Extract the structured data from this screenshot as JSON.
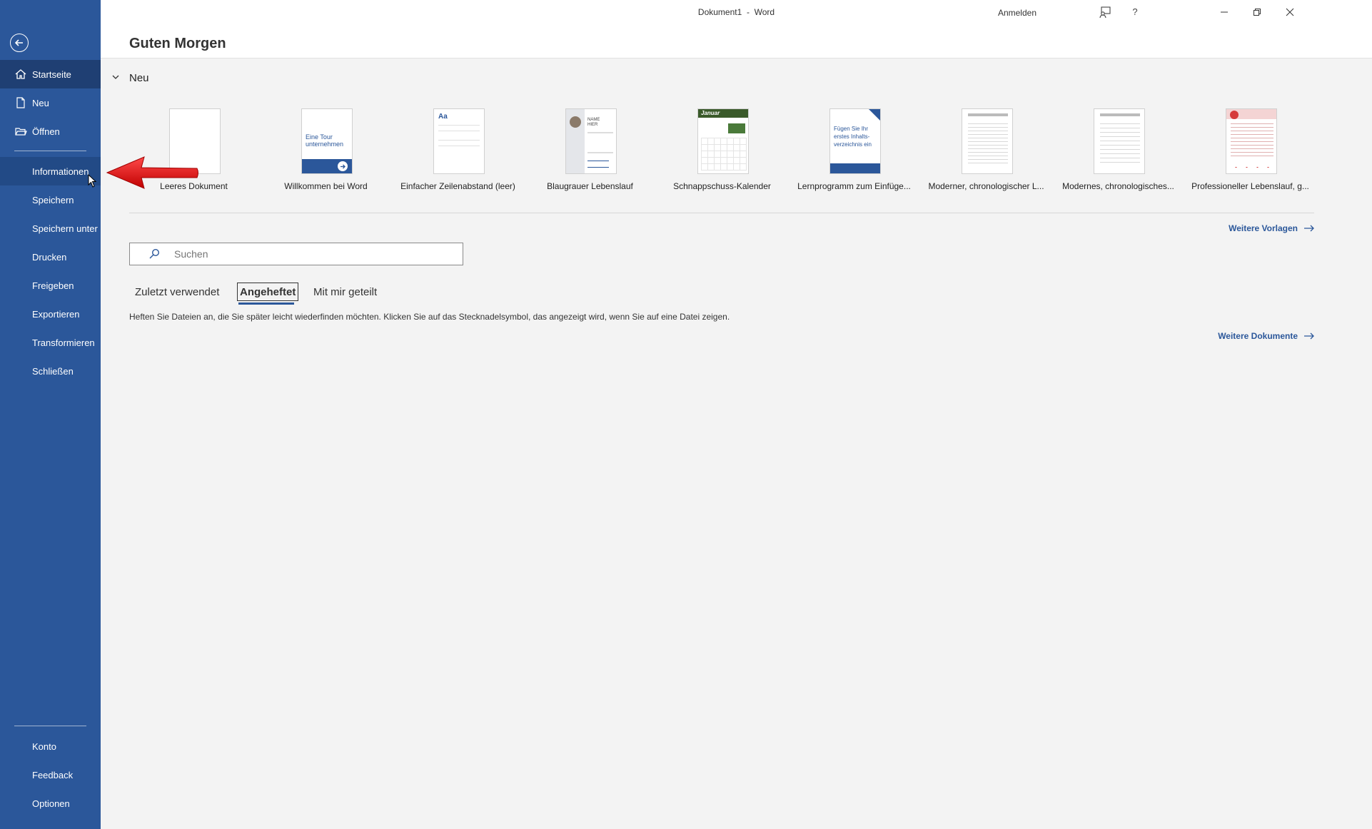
{
  "window": {
    "title": "Dokument1  -  Word",
    "signin_label": "Anmelden"
  },
  "sidebar": {
    "top_items": [
      {
        "label": "Startseite",
        "icon": "home-icon"
      },
      {
        "label": "Neu",
        "icon": "new-document-icon"
      },
      {
        "label": "Öffnen",
        "icon": "folder-open-icon"
      }
    ],
    "middle_items": [
      {
        "label": "Informationen"
      },
      {
        "label": "Speichern"
      },
      {
        "label": "Speichern unter"
      },
      {
        "label": "Drucken"
      },
      {
        "label": "Freigeben"
      },
      {
        "label": "Exportieren"
      },
      {
        "label": "Transformieren"
      },
      {
        "label": "Schließen"
      }
    ],
    "bottom_items": [
      {
        "label": "Konto"
      },
      {
        "label": "Feedback"
      },
      {
        "label": "Optionen"
      }
    ],
    "active_item": "Startseite",
    "hovered_item": "Informationen"
  },
  "main": {
    "greeting": "Guten Morgen",
    "new_section_title": "Neu",
    "templates": [
      {
        "name": "Leeres Dokument"
      },
      {
        "name": "Willkommen bei Word",
        "thumb_text": "Eine Tour unternehmen"
      },
      {
        "name": "Einfacher Zeilenabstand (leer)",
        "thumb_text": "Aa"
      },
      {
        "name": "Blaugrauer Lebenslauf",
        "thumb_text": "NAME HIER"
      },
      {
        "name": "Schnappschuss-Kalender",
        "thumb_text": "Januar"
      },
      {
        "name": "Lernprogramm zum Einfüge...",
        "thumb_text": "Fügen Sie Ihr erstes Inhalts-verzeichnis ein"
      },
      {
        "name": "Moderner, chronologischer L..."
      },
      {
        "name": "Modernes, chronologisches..."
      },
      {
        "name": "Professioneller Lebenslauf, g..."
      }
    ],
    "more_templates_label": "Weitere Vorlagen",
    "search": {
      "placeholder": "Suchen"
    },
    "tabs": [
      {
        "label": "Zuletzt verwendet"
      },
      {
        "label": "Angeheftet"
      },
      {
        "label": "Mit mir geteilt"
      }
    ],
    "selected_tab": "Angeheftet",
    "pinned_info": "Heften Sie Dateien an, die Sie später leicht wiederfinden möchten. Klicken Sie auf das Stecknadelsymbol, das angezeigt wird, wenn Sie auf eine Datei zeigen.",
    "more_documents_label": "Weitere Dokumente"
  },
  "colors": {
    "sidebar": "#2b579a",
    "sidebar_active": "#1f3f73",
    "accent": "#2b579a",
    "annotation_arrow": "#e8000b"
  }
}
